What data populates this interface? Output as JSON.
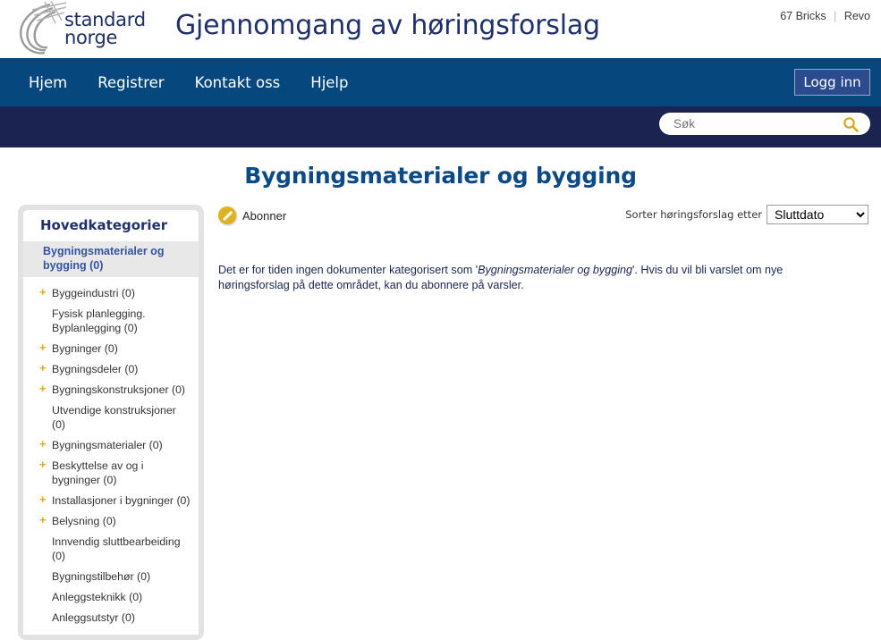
{
  "header": {
    "logo_line1": "standard",
    "logo_line2": "norge",
    "logo_icon": "swoosh-logo-icon",
    "site_title": "Gjennomgang av høringsforslag",
    "credit_primary": "67 Bricks",
    "credit_separator": "|",
    "credit_secondary": "Revo"
  },
  "nav": {
    "items": [
      {
        "label": "Hjem"
      },
      {
        "label": "Registrer"
      },
      {
        "label": "Kontakt oss"
      },
      {
        "label": "Hjelp"
      }
    ],
    "login_label": "Logg inn"
  },
  "search": {
    "placeholder": "Søk",
    "value": "",
    "icon": "search-icon"
  },
  "page": {
    "title": "Bygningsmaterialer og bygging"
  },
  "sidebar": {
    "heading": "Hovedkategorier",
    "current": "Bygningsmaterialer og bygging (0)",
    "items": [
      {
        "label": "Byggeindustri (0)",
        "expander": "+"
      },
      {
        "label": "Fysisk planlegging. Byplanlegging (0)",
        "expander": ""
      },
      {
        "label": "Bygninger (0)",
        "expander": "+"
      },
      {
        "label": "Bygningsdeler (0)",
        "expander": "+"
      },
      {
        "label": "Bygningskonstruksjoner (0)",
        "expander": "+"
      },
      {
        "label": "Utvendige konstruksjoner (0)",
        "expander": ""
      },
      {
        "label": "Bygningsmaterialer (0)",
        "expander": "+"
      },
      {
        "label": "Beskyttelse av og i bygninger (0)",
        "expander": "+"
      },
      {
        "label": "Installasjoner i bygninger (0)",
        "expander": "+"
      },
      {
        "label": "Belysning (0)",
        "expander": "+"
      },
      {
        "label": "Innvendig sluttbearbeiding (0)",
        "expander": ""
      },
      {
        "label": "Bygningstilbehør (0)",
        "expander": ""
      },
      {
        "label": "Anleggsteknikk (0)",
        "expander": ""
      },
      {
        "label": "Anleggsutstyr (0)",
        "expander": ""
      }
    ]
  },
  "main": {
    "subscribe_label": "Abonner",
    "subscribe_icon": "subscribe-bell-icon",
    "sort_label": "Sorter høringsforslag etter",
    "sort_selected": "Sluttdato",
    "sort_options": [
      "Sluttdato"
    ],
    "empty_message_part1": "Det er for tiden ingen dokumenter kategorisert som '",
    "empty_message_emphasis": "Bygningsmaterialer og bygging",
    "empty_message_part2": "'. Hvis du vil bli varslet om nye høringsforslag på dette området, kan du abonnere på varsler."
  },
  "colors": {
    "nav_blue": "#06477d",
    "search_strip_blue": "#1b2450",
    "title_blue": "#0c4a86",
    "accent_gold": "#e0b21f",
    "link_blue": "#3452a4"
  }
}
